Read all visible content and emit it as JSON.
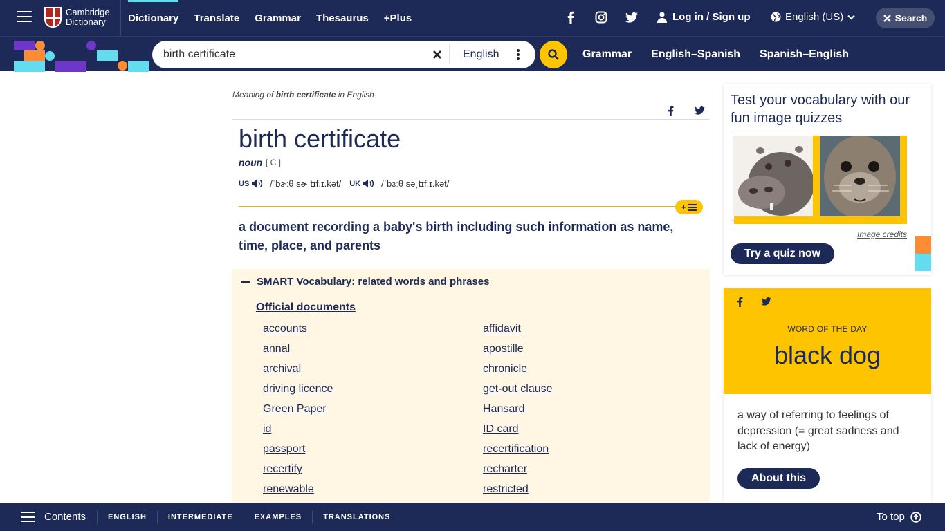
{
  "header": {
    "logo_line1": "Cambridge",
    "logo_line2": "Dictionary",
    "nav": [
      "Dictionary",
      "Translate",
      "Grammar",
      "Thesaurus",
      "+Plus"
    ],
    "login": "Log in / Sign up",
    "language": "English (US)",
    "search_label": "Search"
  },
  "searchbar": {
    "query": "birth certificate",
    "dictionary": "English",
    "links": [
      "Grammar",
      "English–Spanish",
      "Spanish–English"
    ]
  },
  "entry": {
    "meaning_prefix": "Meaning of",
    "meaning_word": "birth certificate",
    "meaning_suffix": "in English",
    "headword": "birth certificate",
    "pos": "noun",
    "grammar": "[ C ]",
    "us_label": "US",
    "us_ipa": "/ˈbɝːθ sɚˌtɪf.ɪ.kət/",
    "uk_label": "UK",
    "uk_ipa": "/ˈbɜːθ səˌtɪf.ɪ.kət/",
    "addlist": "+",
    "definition": "a document recording a baby's birth including such information as name, time, place, and parents"
  },
  "smart": {
    "title": "SMART Vocabulary: related words and phrases",
    "topic": "Official documents",
    "col1": [
      "accounts",
      "annal",
      "archival",
      "driving licence",
      "Green Paper",
      "id",
      "passport",
      "recertify",
      "renewable"
    ],
    "col2": [
      "affidavit",
      "apostille",
      "chronicle",
      "get-out clause",
      "Hansard",
      "ID card",
      "recertification",
      "recharter",
      "restricted"
    ]
  },
  "quiz": {
    "title": "Test your vocabulary with our fun image quizzes",
    "credits": "Image credits",
    "button": "Try a quiz now"
  },
  "wotd": {
    "label": "WORD OF THE DAY",
    "word": "black dog",
    "definition": "a way of referring to feelings of depression (= great sadness and lack of energy)",
    "button": "About this"
  },
  "footer": {
    "contents": "Contents",
    "links": [
      "ENGLISH",
      "INTERMEDIATE",
      "EXAMPLES",
      "TRANSLATIONS"
    ],
    "to_top": "To top"
  },
  "colors": {
    "navy": "#1d2a57",
    "yellow": "#fec400",
    "cyan": "#64dcf0",
    "orange": "#ff8c32",
    "purple": "#6e37c8",
    "cream": "#fff7e3"
  }
}
